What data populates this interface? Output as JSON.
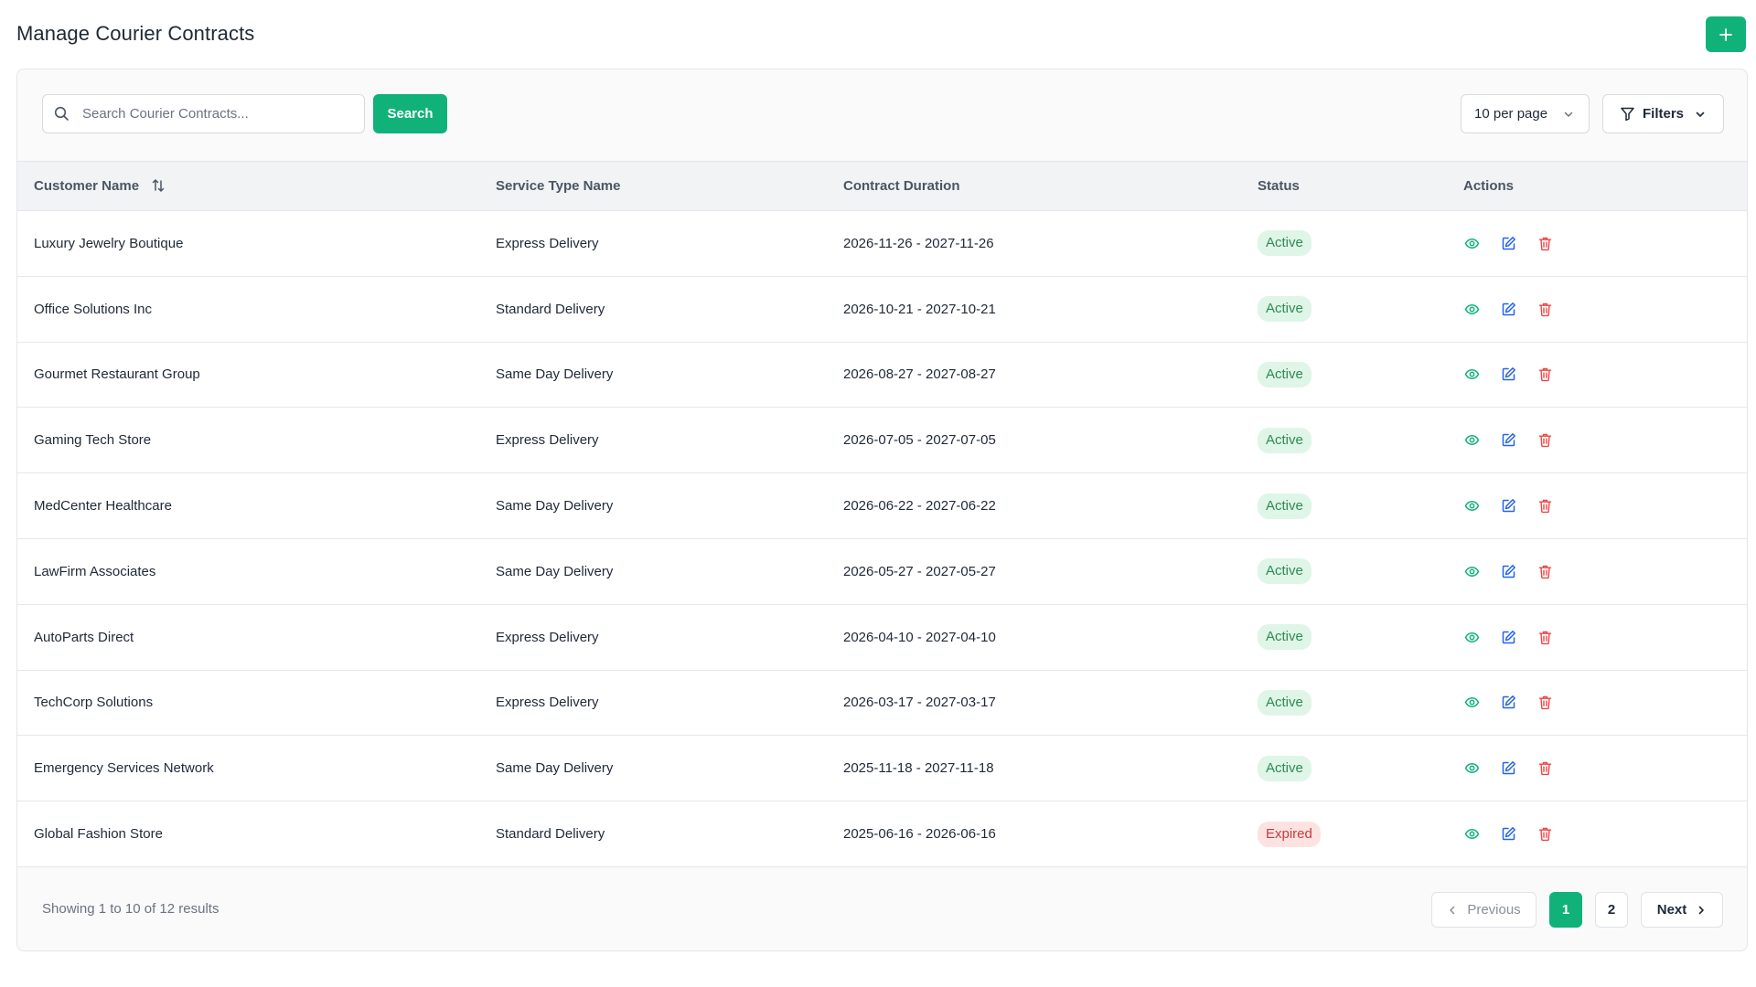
{
  "page": {
    "title": "Manage Courier Contracts"
  },
  "toolbar": {
    "search_placeholder": "Search Courier Contracts...",
    "search_button": "Search",
    "per_page": "10 per page",
    "filters": "Filters"
  },
  "table": {
    "columns": [
      "Customer Name",
      "Service Type Name",
      "Contract Duration",
      "Status",
      "Actions"
    ],
    "rows": [
      {
        "customer": "Luxury Jewelry Boutique",
        "service": "Express Delivery",
        "duration": "2026-11-26 - 2027-11-26",
        "status": "Active"
      },
      {
        "customer": "Office Solutions Inc",
        "service": "Standard Delivery",
        "duration": "2026-10-21 - 2027-10-21",
        "status": "Active"
      },
      {
        "customer": "Gourmet Restaurant Group",
        "service": "Same Day Delivery",
        "duration": "2026-08-27 - 2027-08-27",
        "status": "Active"
      },
      {
        "customer": "Gaming Tech Store",
        "service": "Express Delivery",
        "duration": "2026-07-05 - 2027-07-05",
        "status": "Active"
      },
      {
        "customer": "MedCenter Healthcare",
        "service": "Same Day Delivery",
        "duration": "2026-06-22 - 2027-06-22",
        "status": "Active"
      },
      {
        "customer": "LawFirm Associates",
        "service": "Same Day Delivery",
        "duration": "2026-05-27 - 2027-05-27",
        "status": "Active"
      },
      {
        "customer": "AutoParts Direct",
        "service": "Express Delivery",
        "duration": "2026-04-10 - 2027-04-10",
        "status": "Active"
      },
      {
        "customer": "TechCorp Solutions",
        "service": "Express Delivery",
        "duration": "2026-03-17 - 2027-03-17",
        "status": "Active"
      },
      {
        "customer": "Emergency Services Network",
        "service": "Same Day Delivery",
        "duration": "2025-11-18 - 2027-11-18",
        "status": "Active"
      },
      {
        "customer": "Global Fashion Store",
        "service": "Standard Delivery",
        "duration": "2025-06-16 - 2026-06-16",
        "status": "Expired"
      }
    ]
  },
  "footer": {
    "showing": "Showing 1 to 10 of 12 results",
    "previous": "Previous",
    "pages": [
      "1",
      "2"
    ],
    "current_page": "1",
    "next": "Next"
  },
  "colors": {
    "accent": "#10b27a",
    "view_icon": "#10b27a",
    "edit_icon": "#2563eb",
    "delete_icon": "#ef4444",
    "active_badge_bg": "#dff5e8",
    "expired_badge_bg": "#fde2e2"
  },
  "icons": [
    "plus-icon",
    "search-icon",
    "chevron-down-icon",
    "filter-icon",
    "sort-icon",
    "eye-icon",
    "edit-icon",
    "trash-icon",
    "chevron-left-icon",
    "chevron-right-icon"
  ]
}
